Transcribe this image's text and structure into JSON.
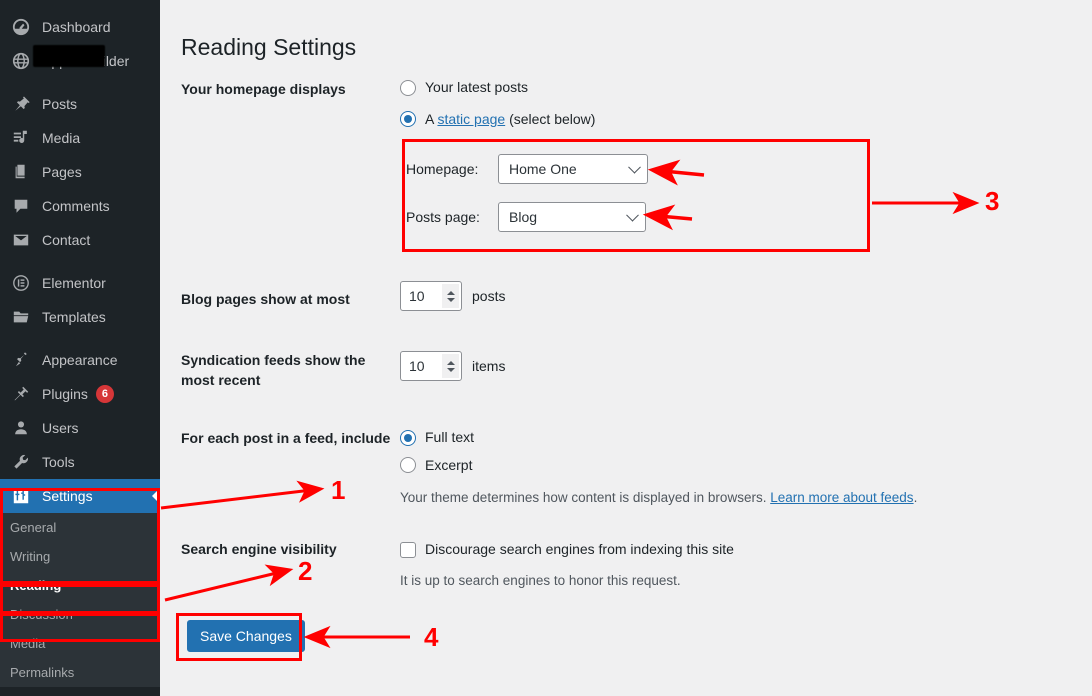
{
  "sidebar": {
    "items": [
      {
        "label": "Dashboard",
        "icon": "dashboard-icon",
        "name": "sidebar-item-dashboard"
      },
      {
        "label": "Appku Builder",
        "icon": "globe-icon",
        "name": "sidebar-item-appku-builder",
        "redacted": true
      },
      {
        "label": "Posts",
        "icon": "pin-icon",
        "name": "sidebar-item-posts"
      },
      {
        "label": "Media",
        "icon": "media-icon",
        "name": "sidebar-item-media"
      },
      {
        "label": "Pages",
        "icon": "pages-icon",
        "name": "sidebar-item-pages"
      },
      {
        "label": "Comments",
        "icon": "comment-icon",
        "name": "sidebar-item-comments"
      },
      {
        "label": "Contact",
        "icon": "envelope-icon",
        "name": "sidebar-item-contact"
      },
      {
        "label": "Elementor",
        "icon": "elementor-icon",
        "name": "sidebar-item-elementor"
      },
      {
        "label": "Templates",
        "icon": "folder-icon",
        "name": "sidebar-item-templates"
      },
      {
        "label": "Appearance",
        "icon": "brush-icon",
        "name": "sidebar-item-appearance"
      },
      {
        "label": "Plugins",
        "icon": "plug-icon",
        "name": "sidebar-item-plugins",
        "badge": "6"
      },
      {
        "label": "Users",
        "icon": "user-icon",
        "name": "sidebar-item-users"
      },
      {
        "label": "Tools",
        "icon": "wrench-icon",
        "name": "sidebar-item-tools"
      },
      {
        "label": "Settings",
        "icon": "sliders-icon",
        "name": "sidebar-item-settings",
        "current": true
      }
    ],
    "submenu": [
      {
        "label": "General",
        "name": "submenu-item-general"
      },
      {
        "label": "Writing",
        "name": "submenu-item-writing"
      },
      {
        "label": "Reading",
        "name": "submenu-item-reading",
        "current": true
      },
      {
        "label": "Discussion",
        "name": "submenu-item-discussion"
      },
      {
        "label": "Media",
        "name": "submenu-item-media"
      },
      {
        "label": "Permalinks",
        "name": "submenu-item-permalinks"
      }
    ],
    "badge_color": "#d63638",
    "current_color": "#2271b1"
  },
  "page": {
    "title": "Reading Settings"
  },
  "homepage_displays": {
    "label": "Your homepage displays",
    "option_latest": "Your latest posts",
    "option_static_prefix": "A ",
    "option_static_link": "static page",
    "option_static_suffix": " (select below)",
    "selected": "static",
    "homepage_label": "Homepage:",
    "homepage_value": "Home One",
    "posts_page_label": "Posts page:",
    "posts_page_value": "Blog"
  },
  "blog_pages": {
    "label": "Blog pages show at most",
    "value": "10",
    "unit": "posts"
  },
  "syndication": {
    "label": "Syndication feeds show the most recent",
    "value": "10",
    "unit": "items"
  },
  "feed_include": {
    "label": "For each post in a feed, include",
    "option_full": "Full text",
    "option_excerpt": "Excerpt",
    "selected": "full",
    "helper_prefix": "Your theme determines how content is displayed in browsers. ",
    "helper_link": "Learn more about feeds",
    "helper_suffix": "."
  },
  "search_visibility": {
    "label": "Search engine visibility",
    "checkbox_label": "Discourage search engines from indexing this site",
    "checked": false,
    "helper": "It is up to search engines to honor this request."
  },
  "actions": {
    "save_label": "Save Changes"
  },
  "annotations": {
    "color": "#ff0000",
    "markers": [
      {
        "number": "1",
        "target": "settings-menu-item"
      },
      {
        "number": "2",
        "target": "reading-discussion-submenu"
      },
      {
        "number": "3",
        "target": "static-page-selection-box"
      },
      {
        "number": "4",
        "target": "save-changes-button"
      }
    ]
  }
}
